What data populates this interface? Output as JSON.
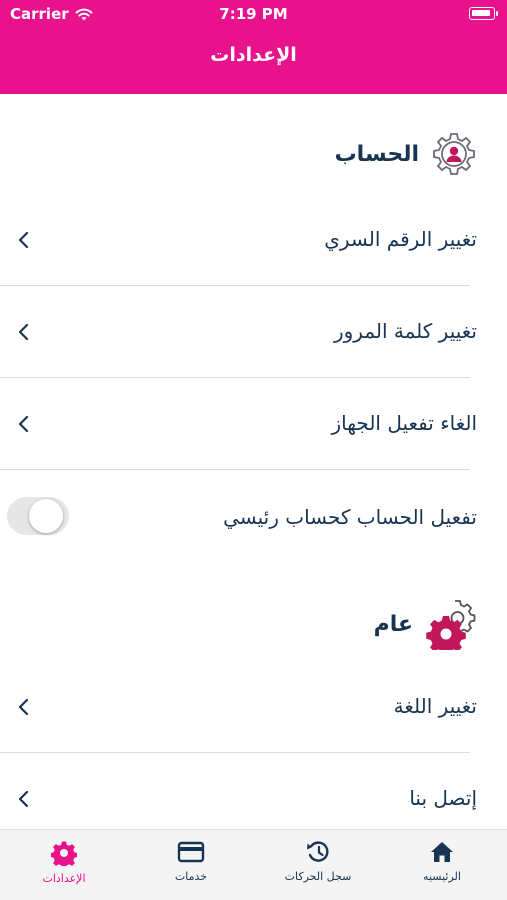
{
  "status_bar": {
    "carrier": "Carrier",
    "time": "7:19 PM"
  },
  "header": {
    "title": "الإعدادات"
  },
  "sections": {
    "account": {
      "title": "الحساب",
      "icon": "account-gear-icon",
      "items": [
        {
          "label": "تغيير الرقم السري"
        },
        {
          "label": "تغيير كلمة المرور"
        },
        {
          "label": "الغاء تفعيل الجهاز"
        }
      ],
      "toggle": {
        "label": "تفعيل الحساب كحساب رئيسي",
        "state": "off"
      }
    },
    "general": {
      "title": "عام",
      "icon": "gears-icon",
      "items": [
        {
          "label": "تغيير اللغة"
        },
        {
          "label": "إتصل بنا"
        }
      ]
    }
  },
  "tabbar": {
    "items": [
      {
        "label": "الرئيسيه",
        "icon": "home-icon"
      },
      {
        "label": "سجل الحركات",
        "icon": "history-icon"
      },
      {
        "label": "خدمات",
        "icon": "card-icon"
      },
      {
        "label": "الإعدادات",
        "icon": "settings-gear-icon",
        "active": true
      }
    ]
  },
  "colors": {
    "brand": "#e8128c",
    "text": "#173552",
    "divider": "#dcdcdc"
  }
}
